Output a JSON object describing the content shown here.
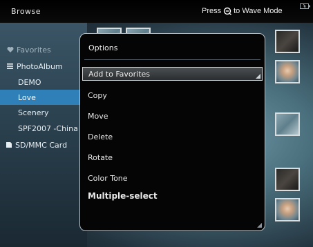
{
  "topbar": {
    "title": "Browse",
    "hint_prefix": "Press",
    "hint_suffix": "to Wave Mode"
  },
  "sidebar": {
    "items": [
      {
        "label": "Favorites",
        "icon": "heart-icon"
      },
      {
        "label": "PhotoAlbum",
        "icon": "list-icon"
      },
      {
        "label": "DEMO"
      },
      {
        "label": "Love"
      },
      {
        "label": "Scenery"
      },
      {
        "label": "SPF2007 -China"
      },
      {
        "label": "SD/MMC Card",
        "icon": "card-icon"
      }
    ],
    "selected": "Love"
  },
  "dialog": {
    "title": "Options",
    "items": [
      {
        "label": "Add to Favorites"
      },
      {
        "label": "Copy"
      },
      {
        "label": "Move"
      },
      {
        "label": "Delete"
      },
      {
        "label": "Rotate"
      },
      {
        "label": "Color Tone"
      },
      {
        "label": "Multiple-select"
      }
    ],
    "selected": "Add to Favorites"
  },
  "colors": {
    "selection": "#2f7fb8",
    "dialog_bg": "#050505",
    "dialog_border": "#b9c3c9"
  }
}
